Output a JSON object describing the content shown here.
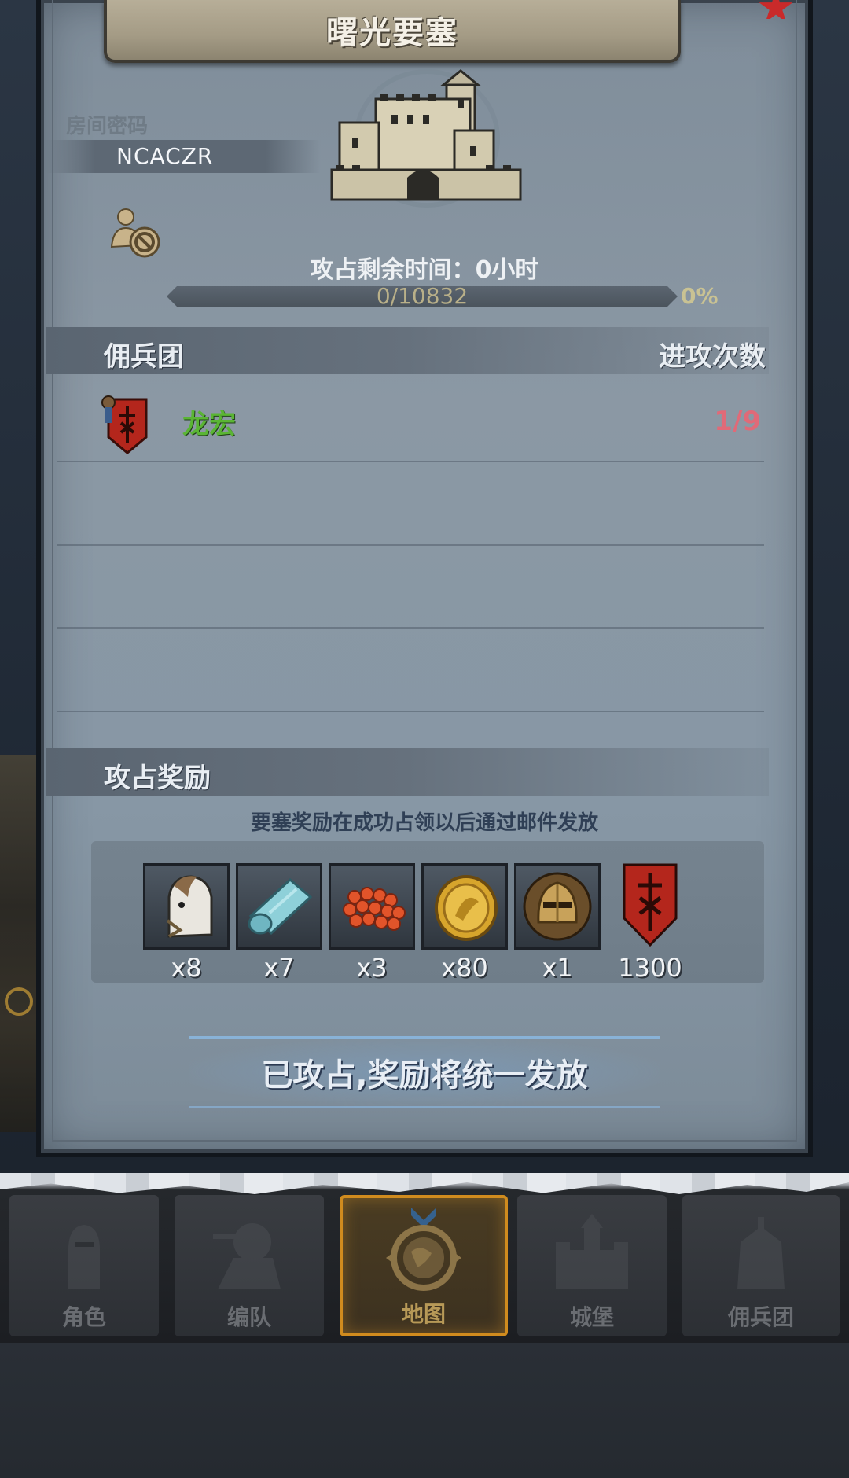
{
  "title": "曙光要塞",
  "room": {
    "label": "房间密码",
    "code": "NCACZR"
  },
  "siege": {
    "remaining_label": "攻占剩余时间：",
    "remaining_value": "0小时"
  },
  "progress": {
    "text": "0/10832",
    "percent_text": "0%",
    "fraction": 0
  },
  "mercenary_section": {
    "label": "佣兵团",
    "attacks_label": "进攻次数"
  },
  "mercenaries": [
    {
      "name": "龙宏",
      "attacks": "1/9"
    }
  ],
  "rewards_section": {
    "label": "攻占奖励",
    "note": "要塞奖励在成功占领以后通过邮件发放"
  },
  "rewards": [
    {
      "icon": "horse-icon",
      "qty": "x8"
    },
    {
      "icon": "cloth-roll-icon",
      "qty": "x7"
    },
    {
      "icon": "orange-beads-icon",
      "qty": "x3"
    },
    {
      "icon": "gold-coin-icon",
      "qty": "x80"
    },
    {
      "icon": "knight-helmet-icon",
      "qty": "x1"
    },
    {
      "icon": "guild-banner-icon",
      "qty": "1300"
    }
  ],
  "claim_banner": "已攻占,奖励将统一发放",
  "nav": [
    {
      "label": "角色",
      "icon": "knight-icon",
      "active": false
    },
    {
      "label": "编队",
      "icon": "warrior-icon",
      "active": false
    },
    {
      "label": "地图",
      "icon": "globe-compass-icon",
      "active": true
    },
    {
      "label": "城堡",
      "icon": "castle-icon",
      "active": false
    },
    {
      "label": "佣兵团",
      "icon": "mercenary-icon",
      "active": false
    }
  ],
  "colors": {
    "merc_name": "#5ab534",
    "attack_count": "#e06a78",
    "active_tab_border": "#d08b1e"
  }
}
